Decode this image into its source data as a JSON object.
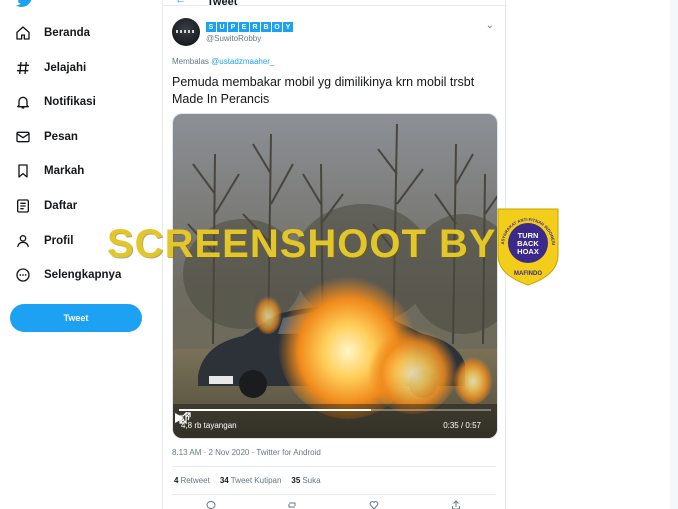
{
  "sidebar": {
    "logo": "twitter-bird-icon",
    "items": [
      {
        "label": "Beranda",
        "icon": "home-icon"
      },
      {
        "label": "Jelajahi",
        "icon": "hashtag-icon"
      },
      {
        "label": "Notifikasi",
        "icon": "bell-icon"
      },
      {
        "label": "Pesan",
        "icon": "mail-icon"
      },
      {
        "label": "Markah",
        "icon": "bookmark-icon"
      },
      {
        "label": "Daftar",
        "icon": "list-icon"
      },
      {
        "label": "Profil",
        "icon": "profile-icon"
      },
      {
        "label": "Selengkapnya",
        "icon": "more-circle-icon"
      }
    ],
    "tweet_button": "Tweet"
  },
  "header": {
    "back_icon": "back-arrow-icon",
    "title": "Tweet"
  },
  "tweet": {
    "display_name": "SUPERBOY",
    "handle": "@SuwitoRobby",
    "more_icon": "more-horizontal-icon",
    "reply_prefix": "Membalas",
    "reply_to": "@ustadzmaaher_",
    "text": "Pemuda membakar mobil yg dimilikinya krn mobil trsbt Made In Perancis",
    "video": {
      "views": "4,8 rb tayangan",
      "time": "0:35 / 0:57",
      "progress": 0.614
    },
    "meta": "8.13 AM · 2 Nov 2020 · Twitter for Android",
    "stats": [
      {
        "count": "4",
        "label": "Retweet"
      },
      {
        "count": "34",
        "label": "Tweet Kutipan"
      },
      {
        "count": "35",
        "label": "Suka"
      }
    ]
  },
  "overlay": {
    "watermark": "SCREENSHOOT BY",
    "badge_ring_text": "MASYARAKAT ANTI FITNAH INDONESIA",
    "badge_center": [
      "TURN",
      "BACK",
      "HOAX"
    ],
    "badge_bottom": "MAFINDO"
  },
  "colors": {
    "accent": "#1da1f2",
    "text": "#14171a",
    "muted": "#657786",
    "watermark": "#e3c62a",
    "badge": "#f2cd1a",
    "badge_inner": "#3b2a8c"
  }
}
